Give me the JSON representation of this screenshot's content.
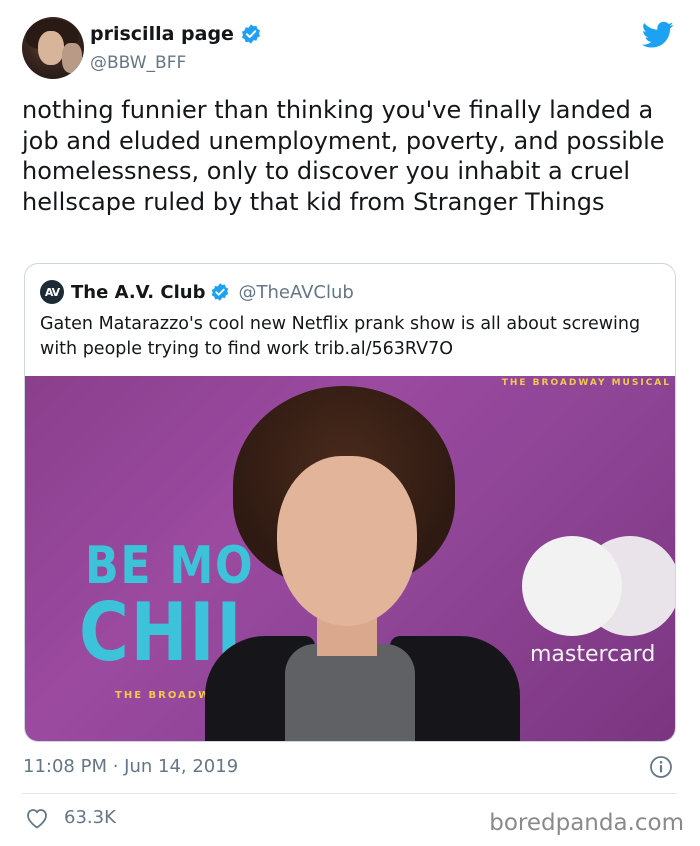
{
  "tweet": {
    "display_name": "priscilla page",
    "handle": "@BBW_BFF",
    "text": "nothing funnier than thinking you've finally landed a job and eluded unemployment, poverty, and possible homelessness, only to discover you inhabit a cruel hellscape ruled by that kid from Stranger Things",
    "timestamp": "11:08 PM · Jun 14, 2019",
    "likes": "63.3K"
  },
  "quote": {
    "logo": "AV",
    "display_name": "The A.V. Club",
    "handle": "@TheAVClub",
    "text": "Gaten Matarazzo's cool new Netflix prank show is all about screwing with people trying to find work trib.al/563RV7O",
    "image": {
      "backdrop_be": "BE MO",
      "backdrop_chi": "CHIL",
      "backdrop_broadway": "THE BROADWAY",
      "backdrop_top": "THE BROADWAY MUSICAL",
      "sponsor": "mastercard"
    }
  },
  "watermark": "boredpanda.com",
  "colors": {
    "accent": "#1da1f2",
    "text": "#14171a",
    "muted": "#657786",
    "border": "#ccd6dd"
  },
  "icons": {
    "verified": "verified-badge-icon",
    "platform": "twitter-bird-icon",
    "info": "info-icon",
    "like": "heart-icon"
  }
}
